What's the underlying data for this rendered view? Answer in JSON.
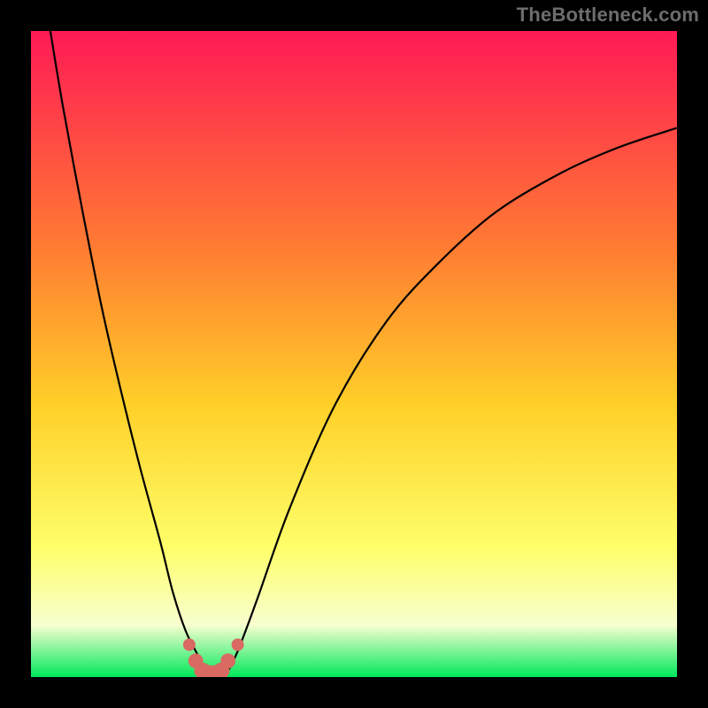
{
  "watermark": "TheBottleneck.com",
  "colors": {
    "bg_black": "#000000",
    "gradient_top": "#ff1a55",
    "gradient_mid_upper": "#ff7a33",
    "gradient_mid": "#ffd028",
    "gradient_lower": "#feff6a",
    "gradient_pale": "#f7ffcf",
    "gradient_bottom": "#00e85a",
    "curve_stroke": "#000000",
    "marker_fill": "#d86a62"
  },
  "chart_data": {
    "type": "line",
    "title": "",
    "xlabel": "",
    "ylabel": "",
    "xlim": [
      0,
      100
    ],
    "ylim": [
      0,
      100
    ],
    "curves": [
      {
        "name": "left_branch",
        "x": [
          3,
          5,
          8,
          11,
          14,
          17,
          20,
          22,
          24,
          26,
          27
        ],
        "y": [
          100,
          88,
          72,
          57,
          44,
          32,
          21,
          13,
          7,
          3,
          0
        ]
      },
      {
        "name": "right_branch",
        "x": [
          30,
          32,
          35,
          40,
          47,
          55,
          63,
          72,
          82,
          91,
          100
        ],
        "y": [
          0,
          4,
          12,
          26,
          42,
          55,
          64,
          72,
          78,
          82,
          85
        ]
      }
    ],
    "valley_markers": {
      "x": [
        24.5,
        25.5,
        26.5,
        27.5,
        28.5,
        29.5,
        30.5,
        32.0
      ],
      "y": [
        5.0,
        2.5,
        1.0,
        0.5,
        0.5,
        1.0,
        2.5,
        5.0
      ],
      "r": [
        1.0,
        1.2,
        1.3,
        1.4,
        1.4,
        1.3,
        1.2,
        1.0
      ]
    }
  }
}
